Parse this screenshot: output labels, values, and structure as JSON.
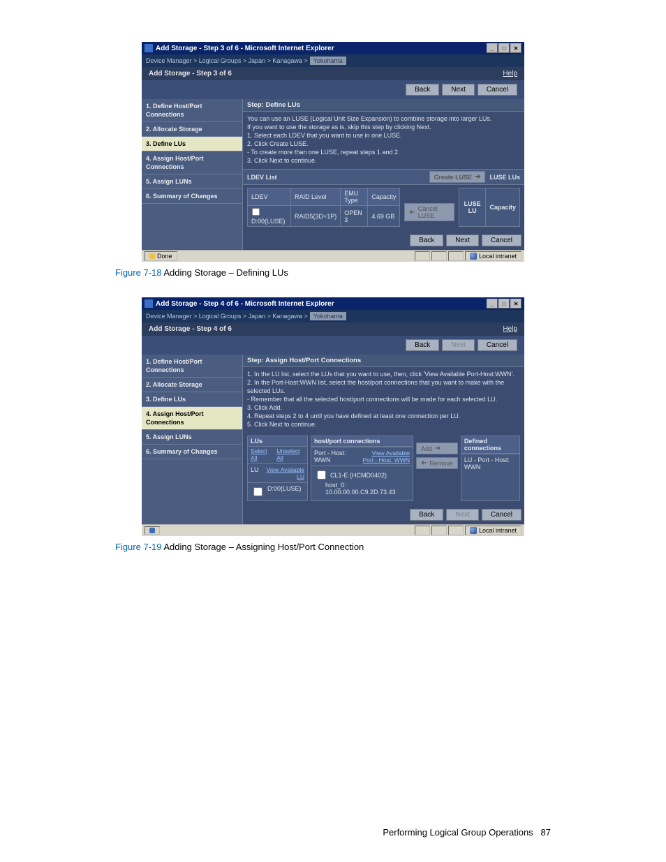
{
  "figureA": {
    "window_title": "Add Storage - Step 3 of 6 - Microsoft Internet Explorer",
    "breadcrumb_prefix": "Device Manager > Logical Groups > Japan > Kanagawa >",
    "breadcrumb_last": "Yokohama",
    "step_title": "Add Storage - Step 3 of 6",
    "help": "Help",
    "buttons": {
      "back": "Back",
      "next": "Next",
      "cancel": "Cancel"
    },
    "sidebar": [
      "1. Define Host/Port Connections",
      "2. Allocate Storage",
      "3. Define LUs",
      "4. Assign Host/Port Connections",
      "5. Assign LUNs",
      "6. Summary of Changes"
    ],
    "active_step_index": 2,
    "step_header": "Step: Define LUs",
    "instructions": "You can use an LUSE (Logical Unit Size Expansion) to combine storage into larger LUs.\nIf you want to use the storage as is, skip this step by clicking Next.\n1. Select each LDEV that you want to use in one LUSE.\n2. Click Create LUSE.\n- To create more than one LUSE, repeat steps 1 and 2.\n3. Click Next to continue.",
    "ldev_list_label": "LDEV List",
    "luse_lus_label": "LUSE LUs",
    "create_luse": "Create LUSE",
    "cancel_luse": "Cancel LUSE",
    "ldev_table": {
      "headers": [
        "LDEV",
        "RAID Level",
        "EMU Type",
        "Capacity"
      ],
      "rows": [
        {
          "ldev": "D:00(LUSE)",
          "raid": "RAID5(3D+1P)",
          "emu": "OPEN 3",
          "cap": "4.69 GB"
        }
      ]
    },
    "luse_table": {
      "headers": [
        "LUSE LU",
        "Capacity"
      ]
    },
    "status": {
      "done": "Done",
      "zone": "Local intranet"
    }
  },
  "figureB": {
    "window_title": "Add Storage - Step 4 of 6 - Microsoft Internet Explorer",
    "breadcrumb_prefix": "Device Manager > Logical Groups > Japan > Kanagawa >",
    "breadcrumb_last": "Yokohama",
    "step_title": "Add Storage - Step 4 of 6",
    "help": "Help",
    "buttons": {
      "back": "Back",
      "next": "Next",
      "cancel": "Cancel"
    },
    "sidebar": [
      "1. Define Host/Port Connections",
      "2. Allocate Storage",
      "3. Define LUs",
      "4. Assign Host/Port Connections",
      "5. Assign LUNs",
      "6. Summary of Changes"
    ],
    "active_step_index": 3,
    "step_header": "Step: Assign Host/Port Connections",
    "instructions": "1. In the LU list, select the LUs that you want to use, then, click 'View Available Port-Host:WWN'.\n2. In the Port-Host:WWN list, select the host/port connections that you want to make with the selected LUs.\n- Remember that all the selected host/port connections will be made for each selected LU.\n3. Click Add.\n4. Repeat steps 2 to 4 until you have defined at least one connection per LU.\n5. Click Next to continue.",
    "lus_label": "LUs",
    "select_all": "Select All",
    "unselect_all": "Unselect All",
    "view_avail_lu": "View Available LU",
    "hostport_label": "host/port connections",
    "porthost_label": "Port - Host: WWN",
    "view_avail_phw": "View Available Port - Host: WWN",
    "defined_label": "Defined connections",
    "defined_sub": "LU - Port - Host: WWN",
    "add_btn": "Add",
    "remove_btn": "Remove",
    "lu_row": "D:00(LUSE)",
    "lu_prefix": "LU",
    "conn_row": {
      "line1": "CL1-E (HCMD0402)",
      "line2": "host_0: 10.00.00.00.C9.2D.73.43"
    },
    "status": {
      "zone": "Local intranet"
    }
  },
  "captions": {
    "fig1_label": "Figure 7-18",
    "fig1_text": " Adding Storage – Defining LUs",
    "fig2_label": "Figure 7-19",
    "fig2_text": " Adding Storage – Assigning Host/Port Connection"
  },
  "footer": {
    "text": "Performing Logical Group Operations",
    "page": "87"
  }
}
